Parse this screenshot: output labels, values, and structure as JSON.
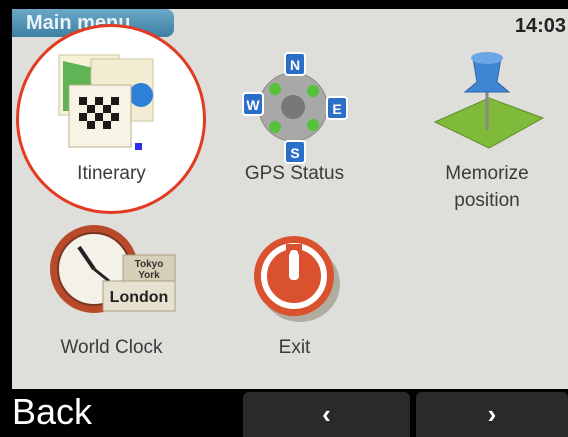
{
  "header": {
    "title": "Main menu",
    "time": "14:03"
  },
  "menu": [
    {
      "label": "Itinerary"
    },
    {
      "label": "GPS Status"
    },
    {
      "label_line1": "Memorize",
      "label_line2": "position"
    },
    {
      "label": "World Clock"
    },
    {
      "label": "Exit"
    }
  ],
  "world_clock_icon": {
    "city_top": "Tokyo",
    "city_mid": "York",
    "city_main": "London"
  },
  "gps_icon": {
    "n": "N",
    "e": "E",
    "s": "S",
    "w": "W"
  },
  "softkeys": {
    "back": "Back",
    "prev": "‹",
    "next": "›"
  },
  "colors": {
    "highlight_ring": "#e23b22",
    "title_bar": "#4f8db0"
  }
}
